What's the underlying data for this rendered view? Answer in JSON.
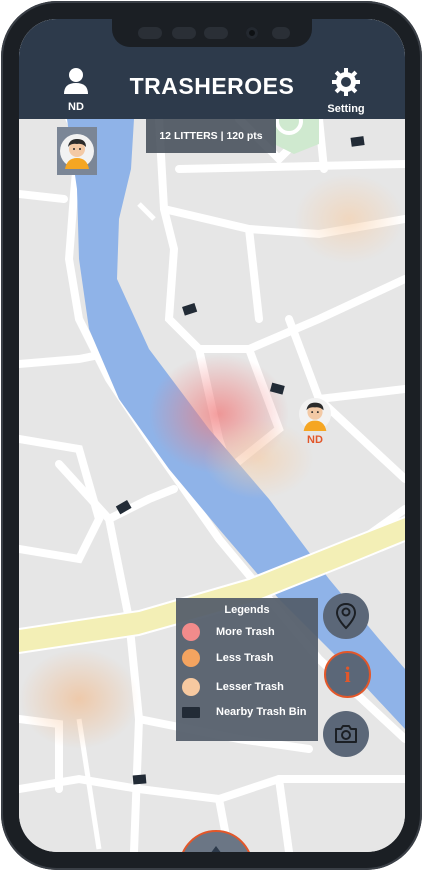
{
  "header": {
    "title": "TRASHEROES",
    "profile_label": "ND",
    "settings_label": "Setting"
  },
  "stats": {
    "text": "12 LITTERS | 120 pts"
  },
  "user_pin": {
    "initials": "ND"
  },
  "legend": {
    "title": "Legends",
    "items": [
      {
        "label": "More Trash",
        "color": "#f28b8b"
      },
      {
        "label": "Less Trash",
        "color": "#f4a460"
      },
      {
        "label": "Lesser Trash",
        "color": "#f7c9a0"
      },
      {
        "label": "Nearby Trash Bin",
        "color": "#222b36"
      }
    ]
  },
  "fabs": {
    "location": "map-pin-icon",
    "info": "i",
    "camera": "camera-icon"
  },
  "colors": {
    "header": "#2d3a4b",
    "accent": "#e2572a",
    "river": "#8fb3e8",
    "road_major": "#f3efb6"
  }
}
